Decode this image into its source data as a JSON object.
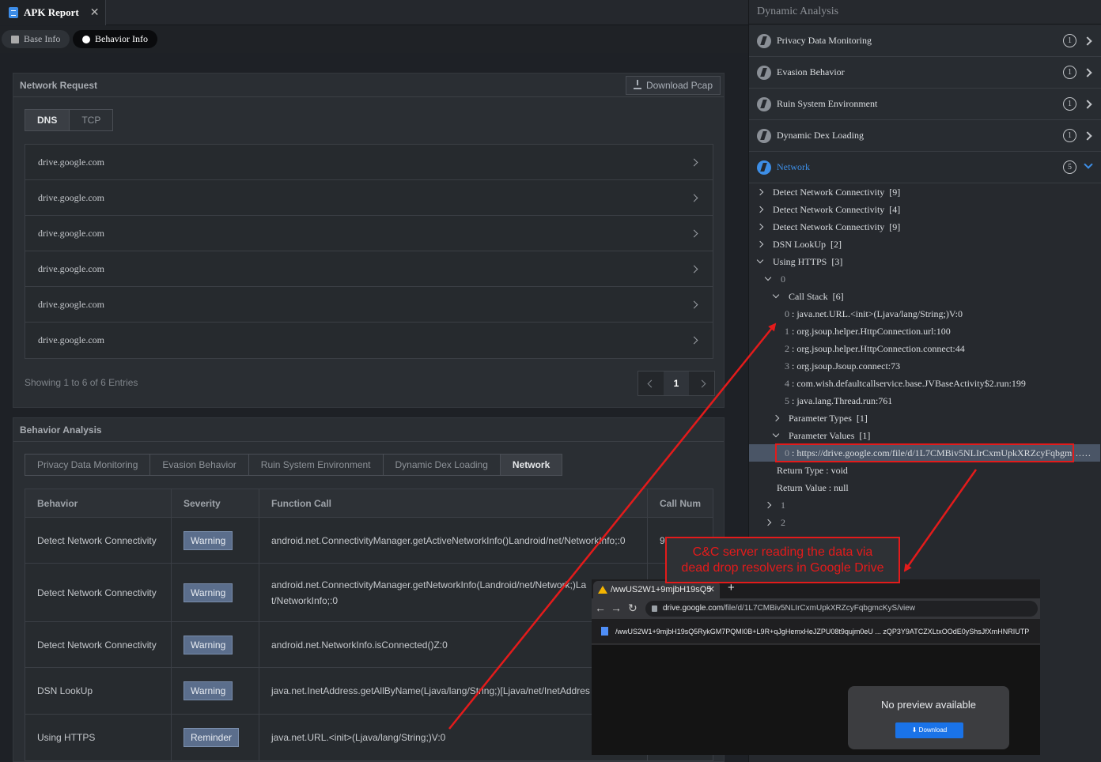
{
  "window": {
    "tab_title": "APK Report",
    "close_glyph": "✕"
  },
  "subtabs": {
    "base": "Base Info",
    "behavior": "Behavior Info"
  },
  "network_request": {
    "title": "Network Request",
    "download_label": "Download Pcap",
    "tabs": [
      "DNS",
      "TCP"
    ],
    "rows": [
      "drive.google.com",
      "drive.google.com",
      "drive.google.com",
      "drive.google.com",
      "drive.google.com",
      "drive.google.com"
    ],
    "entries_text": "Showing 1 to 6 of 6 Entries",
    "page": "1"
  },
  "behavior_analysis": {
    "title": "Behavior Analysis",
    "tabs": [
      "Privacy Data Monitoring",
      "Evasion Behavior",
      "Ruin System Environment",
      "Dynamic Dex Loading",
      "Network"
    ],
    "columns": [
      "Behavior",
      "Severity",
      "Function Call",
      "Call Num"
    ],
    "rows": [
      {
        "behavior": "Detect Network Connectivity",
        "severity": "Warning",
        "call": "android.net.ConnectivityManager.getActiveNetworkInfo()Landroid/net/NetworkInfo;:0",
        "num": "9"
      },
      {
        "behavior": "Detect Network Connectivity",
        "severity": "Warning",
        "call": "android.net.ConnectivityManager.getNetworkInfo(Landroid/net/Network;)La t/NetworkInfo;:0",
        "num": ""
      },
      {
        "behavior": "Detect Network Connectivity",
        "severity": "Warning",
        "call": "android.net.NetworkInfo.isConnected()Z:0",
        "num": ""
      },
      {
        "behavior": "DSN LookUp",
        "severity": "Warning",
        "call": "java.net.InetAddress.getAllByName(Ljava/lang/String;)[Ljava/net/InetAddres",
        "num": ""
      },
      {
        "behavior": "Using HTTPS",
        "severity": "Reminder",
        "call": "java.net.URL.<init>(Ljava/lang/String;)V:0",
        "num": ""
      }
    ]
  },
  "dynamic_analysis": {
    "title": "Dynamic Analysis",
    "categories": [
      {
        "label": "Privacy Data Monitoring",
        "count": "1"
      },
      {
        "label": "Evasion Behavior",
        "count": "1"
      },
      {
        "label": "Ruin System Environment",
        "count": "1"
      },
      {
        "label": "Dynamic Dex Loading",
        "count": "1"
      },
      {
        "label": "Network",
        "count": "5"
      }
    ],
    "tree": {
      "n1": "Detect Network Connectivity",
      "n1c": "[9]",
      "n2": "Detect Network Connectivity",
      "n2c": "[4]",
      "n3": "Detect Network Connectivity",
      "n3c": "[9]",
      "n4": "DSN LookUp",
      "n4c": "[2]",
      "n5": "Using HTTPS",
      "n5c": "[3]",
      "idx0": "0",
      "callstack": "Call Stack",
      "callstack_c": "[6]",
      "cs": [
        {
          "i": "0",
          "t": "java.net.URL.<init>(Ljava/lang/String;)V:0"
        },
        {
          "i": "1",
          "t": "org.jsoup.helper.HttpConnection.url:100"
        },
        {
          "i": "2",
          "t": "org.jsoup.helper.HttpConnection.connect:44"
        },
        {
          "i": "3",
          "t": "org.jsoup.Jsoup.connect:73"
        },
        {
          "i": "4",
          "t": "com.wish.defaultcallservice.base.JVBaseActivity$2.run:199"
        },
        {
          "i": "5",
          "t": "java.lang.Thread.run:761"
        }
      ],
      "ptypes": "Parameter Types",
      "ptypes_c": "[1]",
      "pvalues": "Parameter Values",
      "pvalues_c": "[1]",
      "pv0_i": "0",
      "pv0": "https://drive.google.com/file/d/1L7CMBiv5NLIrCxmUpkXRZcyFqbgm…K…",
      "ret_type": "Return Type : void",
      "ret_val": "Return Value : null",
      "idx1": "1",
      "idx2": "2"
    }
  },
  "annotation": {
    "line1": "C&C server reading the data via",
    "line2": "dead drop resolvers in Google Drive"
  },
  "browser": {
    "tab_title": "/wwUS2W1+9mjbH19sQ5",
    "url_domain": "drive.google.com",
    "url_path": "/file/d/1L7CMBiv5NLIrCxmUpkXRZcyFqbgmcKyS/view",
    "file_name": "/wwUS2W1+9mjbH19sQ5RykGM7PQMI0B+L9R+qJgHemxHeJZPU08t9qujm0eU ... zQP3Y9ATCZXLtxOOdE0yShsJfXmHNRIUTP",
    "no_preview": "No preview available",
    "download": "Download"
  },
  "colors": {
    "accent": "#3d8ee6",
    "annotation": "#e31b1b",
    "badge": "#5b6e8c"
  },
  "icons": [
    "file-icon",
    "info-icon",
    "download-icon",
    "bolt-icon",
    "chevron-right-icon",
    "chevron-down-icon",
    "lock-icon"
  ]
}
